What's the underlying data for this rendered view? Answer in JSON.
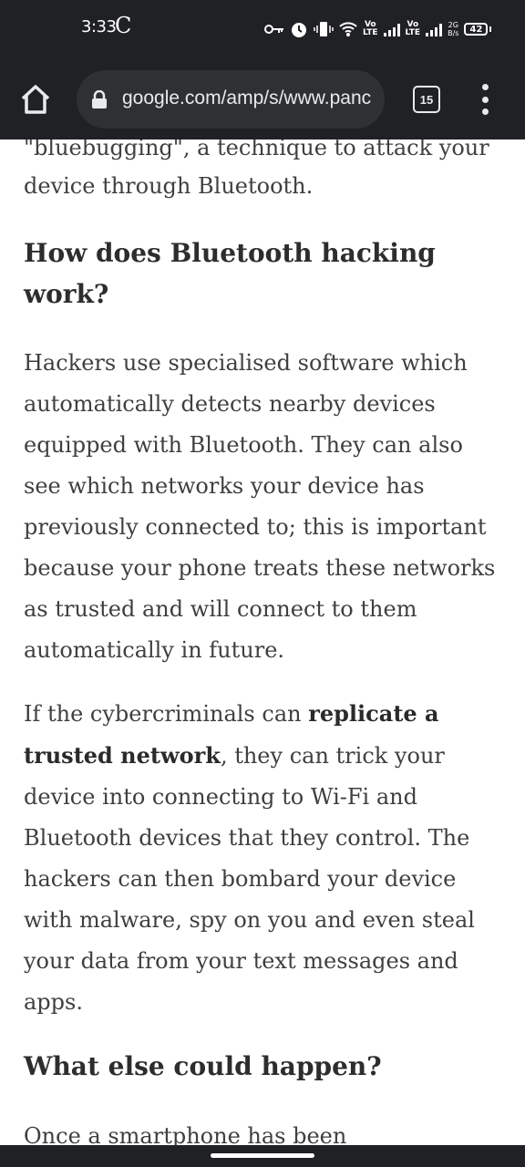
{
  "status_bar": {
    "time": "3:33",
    "carrier_glyph": "C",
    "volte_1": "Vo\nLTE",
    "volte_2": "Vo\nLTE",
    "net_speed": "2G\nB/s",
    "battery": "42",
    "icons": [
      "key-icon",
      "alarm-icon",
      "vibrate-icon",
      "wifi-icon",
      "signal-icon",
      "signal-icon",
      "battery-icon"
    ]
  },
  "browser": {
    "url": "google.com/amp/s/www.panc",
    "tab_count": "15",
    "icons": [
      "home-icon",
      "lock-icon",
      "tabs-icon",
      "more-vert-icon"
    ]
  },
  "article": {
    "top_partial": "\"bluebugging\", a technique to attack your",
    "p0_end": "device through Bluetooth.",
    "heading1": "How does Bluetooth hacking work?",
    "para1": "Hackers use specialised software which automatically detects nearby devices equipped with Bluetooth. They can also see which networks your device has previously connected to; this is important because your phone treats these networks as trusted and will connect to them automatically in future.",
    "para2_before": "If the cybercriminals can ",
    "para2_bold": "replicate a trusted network",
    "para2_after": ", they can trick your device into connecting to Wi-Fi and Bluetooth devices that they control. The hackers can then bombard your device with malware, spy on you and even steal your data from your text messages and apps.",
    "heading2": "What else could happen?",
    "para3_partial": "Once a smartphone has been"
  }
}
